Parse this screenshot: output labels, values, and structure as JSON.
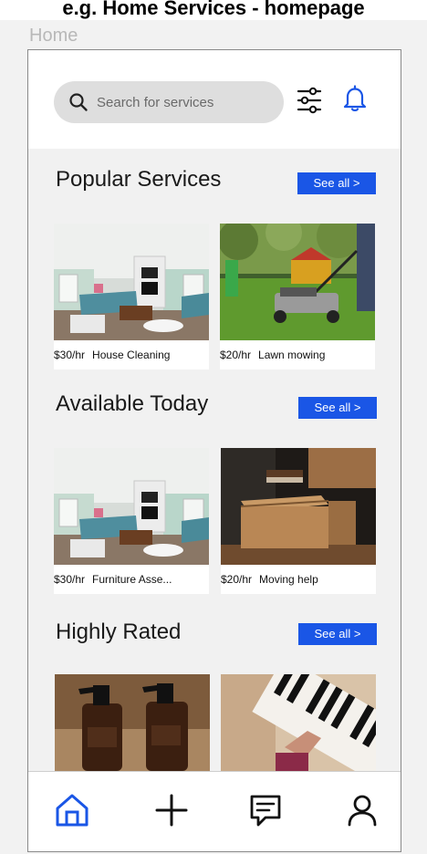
{
  "banner": {
    "text": "e.g. Home Services - homepage"
  },
  "frame": {
    "label": "Home"
  },
  "search": {
    "placeholder": "Search for services"
  },
  "icons": {
    "search": "search-icon",
    "filter": "sliders-icon",
    "notifications": "bell-icon",
    "nav_home": "home-icon",
    "nav_add": "plus-icon",
    "nav_messages": "message-icon",
    "nav_profile": "user-icon"
  },
  "colors": {
    "accent": "#1a56e6",
    "background": "#f1f1f1"
  },
  "sections": [
    {
      "title": "Popular Services",
      "see_all": "See all >",
      "cards": [
        {
          "price": "$30/hr",
          "name": "House Cleaning",
          "image": "living-room-photo"
        },
        {
          "price": "$20/hr",
          "name": "Lawn mowing",
          "image": "lawn-mower-photo"
        }
      ]
    },
    {
      "title": "Available Today",
      "see_all": "See all >",
      "cards": [
        {
          "price": "$30/hr",
          "name": "Furniture Asse...",
          "image": "living-room-photo"
        },
        {
          "price": "$20/hr",
          "name": "Moving help",
          "image": "moving-box-photo"
        }
      ]
    },
    {
      "title": "Highly Rated",
      "see_all": "See all >",
      "cards": [
        {
          "image": "spray-bottles-photo"
        },
        {
          "image": "piano-lesson-photo"
        }
      ]
    }
  ]
}
